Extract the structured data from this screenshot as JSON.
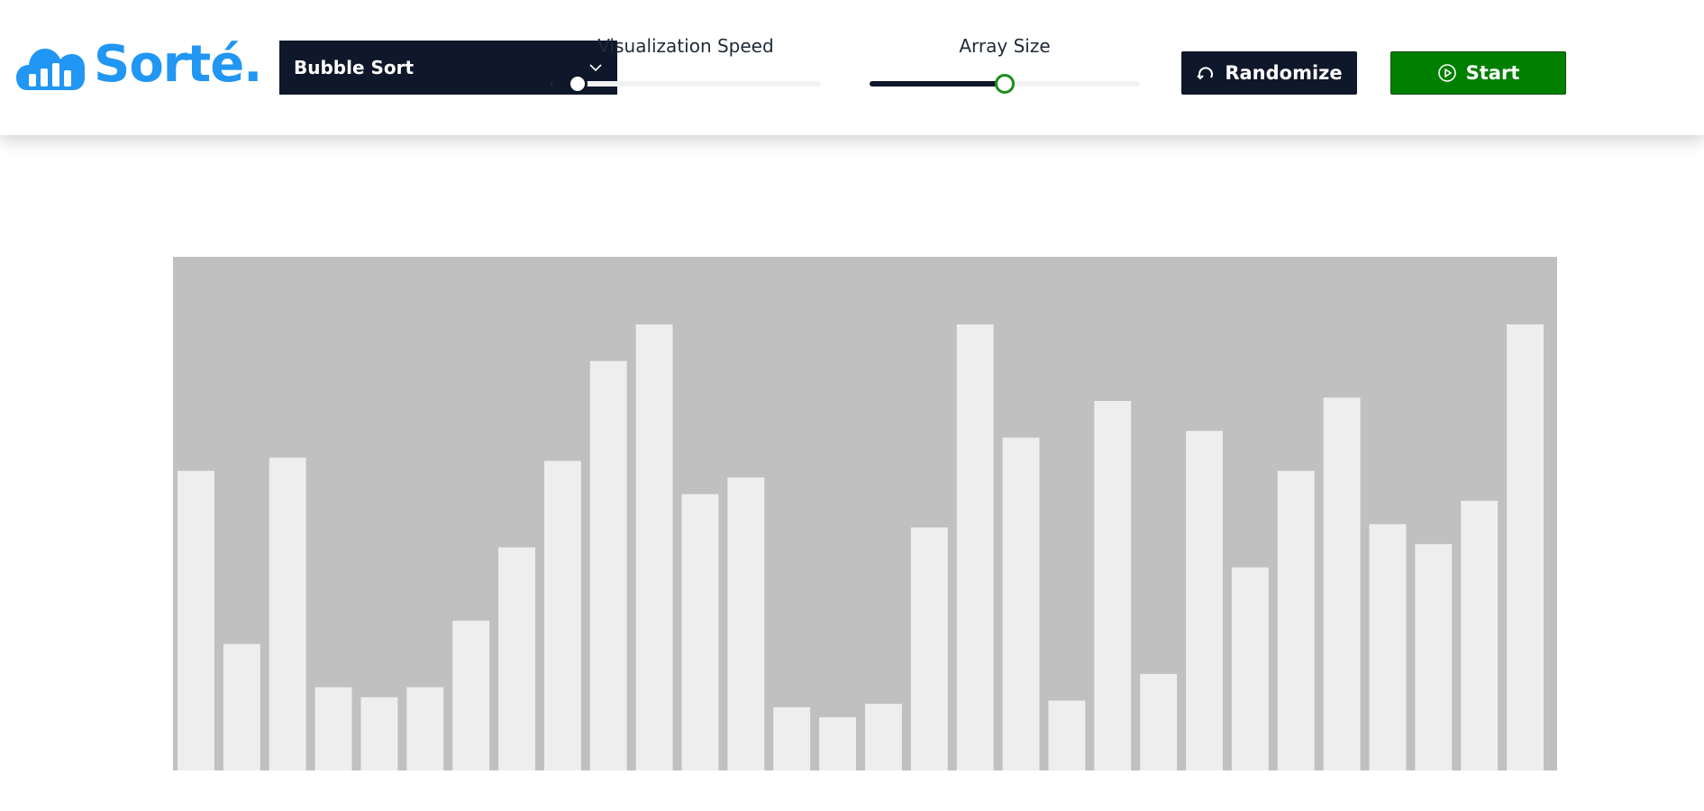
{
  "app": {
    "logo_text": "Sorté.",
    "logo_icon": "cloud-bars-icon",
    "brand_color": "#2196f3"
  },
  "controls": {
    "algorithm_select": {
      "selected": "Bubble Sort",
      "icon": "chevron-down-icon"
    },
    "speed_slider": {
      "label": "Visualization Speed",
      "value_fraction": 0.1
    },
    "size_slider": {
      "label": "Array Size",
      "value_fraction": 0.5
    },
    "randomize_button": {
      "label": "Randomize",
      "icon": "refresh-icon"
    },
    "start_button": {
      "label": "Start",
      "icon": "play-circle-icon"
    }
  },
  "colors": {
    "dark": "#0f172a",
    "start_green": "#008000",
    "bar_fill": "#eeeeee",
    "chart_bg": "#c0c0c0"
  },
  "chart_data": {
    "type": "bar",
    "values": [
      90,
      38,
      94,
      25,
      22,
      25,
      45,
      67,
      93,
      123,
      134,
      83,
      88,
      19,
      16,
      20,
      73,
      134,
      100,
      21,
      111,
      29,
      102,
      61,
      90,
      112,
      74,
      68,
      81,
      134
    ]
  }
}
